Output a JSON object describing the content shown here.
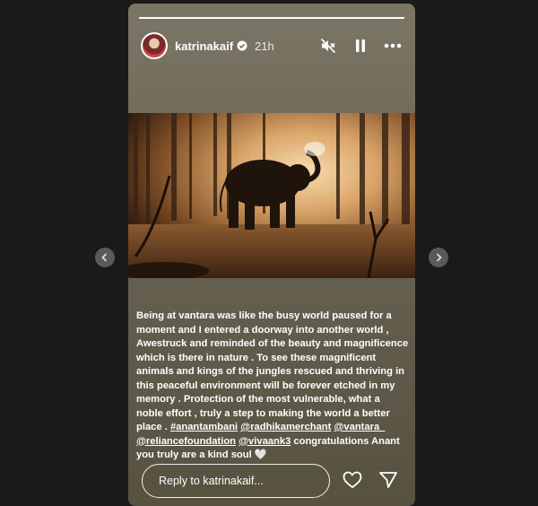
{
  "story": {
    "username": "katrinakaif",
    "time": "21h",
    "progress": 1.0
  },
  "caption": {
    "text": "Being at vantara was like the busy world paused for a moment and I entered a doorway into another world , Awestruck and reminded of the beauty and magnificence which is there in nature . To see these magnificent animals and kings of the jungles rescued and thriving in this peaceful environment will be forever etched in my memory . Protection of the most vulnerable, what a noble effort , truly a step to making the world a better place .",
    "tags": [
      "#anantambani",
      "@radhikamerchant",
      "@vantara_",
      "@reliancefoundation",
      "@vivaank3"
    ],
    "after_tags": "congratulations",
    "closing": "Anant you truly are a kind soul",
    "emoji": "🤍"
  },
  "reply": {
    "placeholder": "Reply to katrinakaif..."
  },
  "icons": {
    "mute": "speaker-muted-icon",
    "pause": "pause-icon",
    "more": "more-options-icon",
    "like": "heart-icon",
    "share": "send-icon",
    "prev": "chevron-left-icon",
    "next": "chevron-right-icon",
    "verified": "verified-badge-icon"
  }
}
